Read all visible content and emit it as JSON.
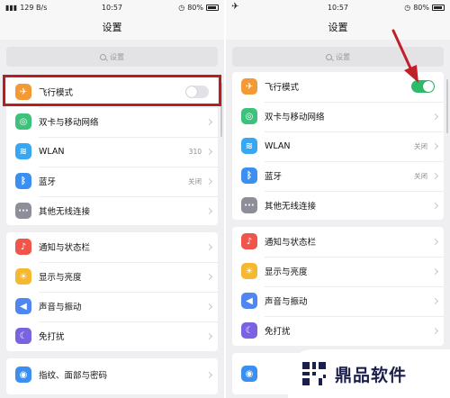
{
  "status_bar": {
    "left": {
      "network_text": "129 B/s",
      "time": "10:57",
      "battery": "80%"
    },
    "right": {
      "time": "10:57",
      "battery": "80%"
    }
  },
  "header": {
    "title": "设置"
  },
  "search": {
    "placeholder": "设置"
  },
  "left_panel": {
    "group1": [
      {
        "label": "飞行模式",
        "icon": "airplane-icon",
        "color": "#f39a35",
        "toggle": "off"
      },
      {
        "label": "双卡与移动网络",
        "icon": "globe-icon",
        "color": "#3cc27a"
      },
      {
        "label": "WLAN",
        "icon": "wifi-icon",
        "color": "#36a7f0",
        "value": "310"
      },
      {
        "label": "蓝牙",
        "icon": "bluetooth-icon",
        "color": "#3a8ff0",
        "value": "关闭"
      },
      {
        "label": "其他无线连接",
        "icon": "more-icon",
        "color": "#8e8e98"
      }
    ],
    "group2": [
      {
        "label": "通知与状态栏",
        "icon": "bell-icon",
        "color": "#f0544a"
      },
      {
        "label": "显示与亮度",
        "icon": "sun-icon",
        "color": "#f5b82e"
      },
      {
        "label": "声音与振动",
        "icon": "speaker-icon",
        "color": "#4f86f0"
      },
      {
        "label": "免打扰",
        "icon": "moon-icon",
        "color": "#7a62e0"
      }
    ],
    "group3": [
      {
        "label": "指纹、面部与密码",
        "icon": "fingerprint-icon",
        "color": "#3a8ff0"
      }
    ]
  },
  "right_panel": {
    "group1": [
      {
        "label": "飞行模式",
        "icon": "airplane-icon",
        "color": "#f39a35",
        "toggle": "on"
      },
      {
        "label": "双卡与移动网络",
        "icon": "globe-icon",
        "color": "#3cc27a"
      },
      {
        "label": "WLAN",
        "icon": "wifi-icon",
        "color": "#36a7f0",
        "value": "关闭"
      },
      {
        "label": "蓝牙",
        "icon": "bluetooth-icon",
        "color": "#3a8ff0",
        "value": "关闭"
      },
      {
        "label": "其他无线连接",
        "icon": "more-icon",
        "color": "#8e8e98"
      }
    ],
    "group2": [
      {
        "label": "通知与状态栏",
        "icon": "bell-icon",
        "color": "#f0544a"
      },
      {
        "label": "显示与亮度",
        "icon": "sun-icon",
        "color": "#f5b82e"
      },
      {
        "label": "声音与振动",
        "icon": "speaker-icon",
        "color": "#4f86f0"
      },
      {
        "label": "免打扰",
        "icon": "moon-icon",
        "color": "#7a62e0"
      }
    ]
  },
  "watermark": {
    "text": "鼎品软件"
  },
  "colors": {
    "highlight": "#b81e1e",
    "toggle_on": "#2dbb6a",
    "arrow": "#c0202a"
  }
}
